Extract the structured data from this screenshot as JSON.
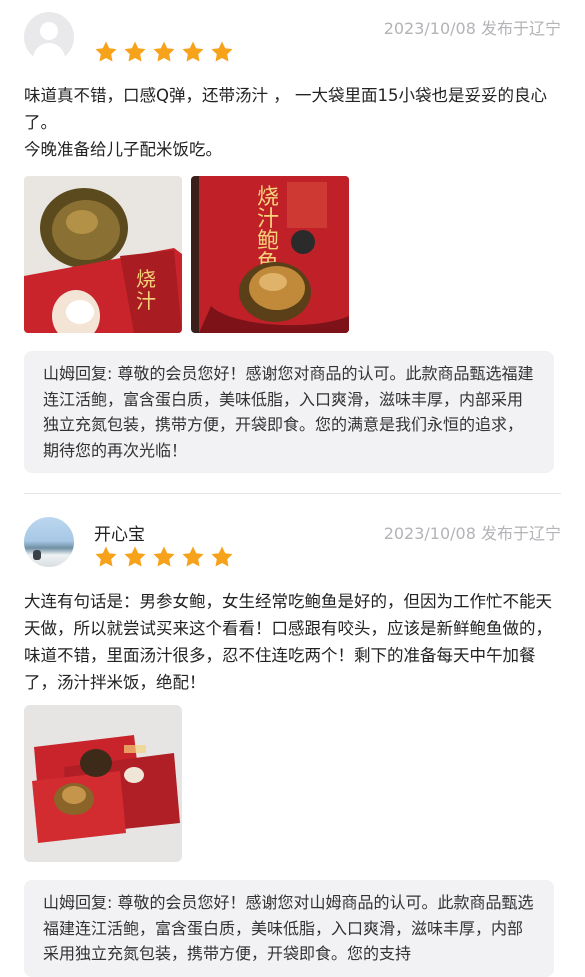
{
  "reviews": [
    {
      "username": "",
      "date": "2023/10/08 发布于辽宁",
      "rating": 5,
      "text_lines": [
        "味道真不错，口感Q弹，还带汤汁 ， 一大袋里面15小袋也是妥妥的良心了。",
        "今晚准备给儿子配米饭吃。"
      ],
      "photos": [
        "abalone-package-in-hand-photo",
        "abalone-package-closeup-photo"
      ],
      "reply": "山姆回复: 尊敬的会员您好！感谢您对商品的认可。此款商品甄选福建连江活鲍，富含蛋白质，美味低脂，入口爽滑，滋味丰厚，内部采用独立充氮包装，携带方便，开袋即食。您的满意是我们永恒的追求，期待您的再次光临！"
    },
    {
      "username": "开心宝",
      "date": "2023/10/08 发布于辽宁",
      "rating": 5,
      "text": "大连有句话是：男参女鲍，女生经常吃鲍鱼是好的，但因为工作忙不能天天做，所以就尝试买来这个看看！口感跟有咬头，应该是新鲜鲍鱼做的，味道不错，里面汤汁很多，忍不住连吃两个！剩下的准备每天中午加餐了，汤汁拌米饭，绝配！",
      "photos": [
        "opened-abalone-packages-photo"
      ],
      "reply": "山姆回复: 尊敬的会员您好！感谢您对山姆商品的认可。此款商品甄选福建连江活鲍，富含蛋白质，美味低脂，入口爽滑，滋味丰厚，内部采用独立充氮包装，携带方便，开袋即食。您的支持"
    }
  ],
  "colors": {
    "star": "#f7a21b",
    "date": "#b3b3b8",
    "reply_bg": "#f2f2f4",
    "package_red": "#c9242b"
  },
  "icons": {
    "star": "star-icon",
    "default_avatar": "user-avatar-placeholder-icon"
  }
}
